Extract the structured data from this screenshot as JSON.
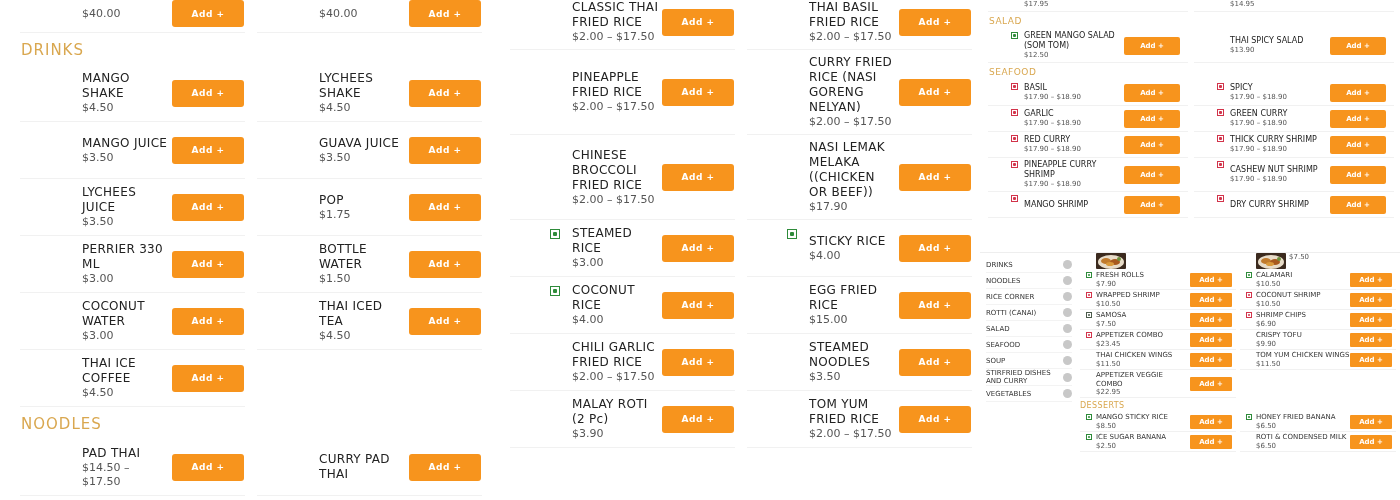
{
  "panels": [
    {
      "kind": "large",
      "blocks": [
        {
          "kind": "row",
          "items": [
            {
              "price": "$40.00",
              "button": "Add +"
            },
            {
              "price": "$40.00",
              "button": "Add +"
            }
          ]
        },
        {
          "kind": "heading",
          "text": "DRINKS"
        },
        {
          "kind": "row",
          "items": [
            {
              "name": "MANGO SHAKE",
              "price": "$4.50",
              "button": "Add +"
            },
            {
              "name": "LYCHEES SHAKE",
              "price": "$4.50",
              "button": "Add +"
            }
          ]
        },
        {
          "kind": "row",
          "items": [
            {
              "name": "MANGO JUICE",
              "price": "$3.50",
              "button": "Add +"
            },
            {
              "name": "GUAVA JUICE",
              "price": "$3.50",
              "button": "Add +"
            }
          ]
        },
        {
          "kind": "row",
          "items": [
            {
              "name": "LYCHEES JUICE",
              "price": "$3.50",
              "button": "Add +"
            },
            {
              "name": "POP",
              "price": "$1.75",
              "button": "Add +"
            }
          ]
        },
        {
          "kind": "row",
          "items": [
            {
              "name": "PERRIER 330 ML",
              "price": "$3.00",
              "button": "Add +"
            },
            {
              "name": "BOTTLE WATER",
              "price": "$1.50",
              "button": "Add +"
            }
          ]
        },
        {
          "kind": "row",
          "items": [
            {
              "name": "COCONUT WATER",
              "price": "$3.00",
              "button": "Add +"
            },
            {
              "name": "THAI ICED TEA",
              "price": "$4.50",
              "button": "Add +"
            }
          ]
        },
        {
          "kind": "row",
          "items": [
            {
              "name": "THAI ICE COFFEE",
              "price": "$4.50",
              "button": "Add +"
            }
          ]
        },
        {
          "kind": "heading",
          "text": "NOODLES"
        },
        {
          "kind": "row",
          "items": [
            {
              "name": "PAD THAI",
              "price": "$14.50 – $17.50",
              "button": "Add +"
            },
            {
              "name": "CURRY PAD THAI",
              "button": "Add +"
            }
          ]
        }
      ]
    },
    {
      "kind": "large",
      "blocks": [
        {
          "kind": "row",
          "items": [
            {
              "name": "CLASSIC THAI FRIED RICE",
              "price": "$2.00 – $17.50",
              "button": "Add +"
            },
            {
              "name": "THAI BASIL FRIED RICE",
              "price": "$2.00 – $17.50",
              "button": "Add +"
            }
          ]
        },
        {
          "kind": "row",
          "items": [
            {
              "name": "PINEAPPLE FRIED RICE",
              "price": "$2.00 – $17.50",
              "button": "Add +"
            },
            {
              "name": "CURRY FRIED RICE (NASI GORENG NELYAN)",
              "price": "$2.00 – $17.50",
              "button": "Add +"
            }
          ]
        },
        {
          "kind": "row",
          "items": [
            {
              "name": "CHINESE BROCCOLI FRIED RICE",
              "price": "$2.00 – $17.50",
              "button": "Add +"
            },
            {
              "name": "NASI LEMAK MELAKA ((CHICKEN OR BEEF))",
              "price": "$17.90",
              "button": "Add +"
            }
          ]
        },
        {
          "kind": "row",
          "items": [
            {
              "name": "STEAMED RICE",
              "price": "$3.00",
              "color": "#2e8b3a",
              "button": "Add +"
            },
            {
              "name": "STICKY RICE",
              "price": "$4.00",
              "color": "#2e8b3a",
              "button": "Add +"
            }
          ]
        },
        {
          "kind": "row",
          "items": [
            {
              "name": "COCONUT RICE",
              "price": "$4.00",
              "color": "#2e8b3a",
              "button": "Add +"
            },
            {
              "name": "EGG FRIED RICE",
              "price": "$15.00",
              "button": "Add +"
            }
          ]
        },
        {
          "kind": "row",
          "items": [
            {
              "name": "CHILI GARLIC FRIED RICE",
              "price": "$2.00 – $17.50",
              "button": "Add +"
            },
            {
              "name": "STEAMED NOODLES",
              "price": "$3.50",
              "button": "Add +"
            }
          ]
        },
        {
          "kind": "row",
          "items": [
            {
              "name": "MALAY ROTI (2 Pc)",
              "price": "$3.90",
              "button": "Add +"
            },
            {
              "name": "TOM YUM FRIED RICE",
              "price": "$2.00 – $17.50",
              "button": "Add +"
            }
          ]
        }
      ]
    },
    {
      "kind": "compact",
      "blocks": [
        {
          "kind": "row",
          "items": [
            {
              "price": "$17.95"
            },
            {
              "price": "$14.95"
            }
          ]
        },
        {
          "kind": "heading",
          "text": "SALAD"
        },
        {
          "kind": "row",
          "items": [
            {
              "name": "GREEN MANGO SALAD (SOM TOM)",
              "price": "$12.50",
              "color": "#2e8b3a",
              "button": "Add +"
            },
            {
              "name": "THAI SPICY SALAD",
              "price": "$13.90",
              "button": "Add +"
            }
          ]
        },
        {
          "kind": "heading",
          "text": "SEAFOOD"
        },
        {
          "kind": "row",
          "items": [
            {
              "name": "BASIL",
              "price": "$17.90 – $18.90",
              "color": "#d2334a",
              "button": "Add +"
            },
            {
              "name": "SPICY",
              "price": "$17.90 – $18.90",
              "color": "#d2334a",
              "button": "Add +"
            }
          ]
        },
        {
          "kind": "row",
          "items": [
            {
              "name": "GARLIC",
              "price": "$17.90 – $18.90",
              "color": "#d2334a",
              "button": "Add +"
            },
            {
              "name": "GREEN CURRY",
              "price": "$17.90 – $18.90",
              "color": "#d2334a",
              "button": "Add +"
            }
          ]
        },
        {
          "kind": "row",
          "items": [
            {
              "name": "RED CURRY",
              "price": "$17.90 – $18.90",
              "color": "#d2334a",
              "button": "Add +"
            },
            {
              "name": "THICK CURRY SHRIMP",
              "price": "$17.90 – $18.90",
              "color": "#d2334a",
              "button": "Add +"
            }
          ]
        },
        {
          "kind": "row",
          "items": [
            {
              "name": "PINEAPPLE CURRY SHRIMP",
              "price": "$17.90 – $18.90",
              "color": "#d2334a",
              "button": "Add +"
            },
            {
              "name": "CASHEW NUT SHRIMP",
              "price": "$17.90 – $18.90",
              "color": "#d2334a",
              "button": "Add +"
            }
          ]
        },
        {
          "kind": "row",
          "items": [
            {
              "name": "MANGO SHRIMP",
              "color": "#d2334a",
              "button": "Add +"
            },
            {
              "name": "DRY CURRY SHRIMP",
              "color": "#d2334a",
              "button": "Add +"
            }
          ]
        }
      ],
      "browser": {
        "categories": [
          {
            "name": "DRINKS"
          },
          {
            "name": "NOODLES"
          },
          {
            "name": "RICE CORNER"
          },
          {
            "name": "ROTTI (CANAI)"
          },
          {
            "name": "SALAD"
          },
          {
            "name": "SEAFOOD"
          },
          {
            "name": "SOUP"
          },
          {
            "name": "STIRFRIED DISHES AND CURRY"
          },
          {
            "name": "VEGETABLES"
          }
        ],
        "blocks": [
          {
            "kind": "photos",
            "items": [
              {
                "kind": "picture"
              },
              {
                "kind": "picture",
                "price": "$7.50"
              }
            ]
          },
          {
            "kind": "row",
            "items": [
              {
                "name": "FRESH ROLLS",
                "price": "$7.90",
                "color": "#2e8b3a",
                "button": "Add +"
              },
              {
                "name": "CALAMARI",
                "price": "$10.50",
                "color": "#2e8b3a",
                "button": "Add +"
              }
            ]
          },
          {
            "kind": "row",
            "items": [
              {
                "name": "WRAPPED SHRIMP",
                "price": "$10.50",
                "color": "#d2334a",
                "button": "Add +"
              },
              {
                "name": "COCONUT SHRIMP",
                "price": "$10.50",
                "color": "#d2334a",
                "button": "Add +"
              }
            ]
          },
          {
            "kind": "row",
            "items": [
              {
                "name": "SAMOSA",
                "price": "$7.50",
                "color": "#4a5a4a",
                "button": "Add +"
              },
              {
                "name": "SHRIMP CHIPS",
                "price": "$6.90",
                "color": "#d2334a",
                "button": "Add +"
              }
            ]
          },
          {
            "kind": "row",
            "items": [
              {
                "name": "APPETIZER COMBO",
                "price": "$23.45",
                "color": "#d2334a",
                "button": "Add +"
              },
              {
                "name": "CRISPY TOFU",
                "price": "$9.90",
                "button": "Add +"
              }
            ]
          },
          {
            "kind": "row",
            "items": [
              {
                "name": "THAI CHICKEN WINGS",
                "price": "$11.50",
                "button": "Add +"
              },
              {
                "name": "TOM YUM CHICKEN WINGS",
                "price": "$11.50",
                "button": "Add +"
              }
            ]
          },
          {
            "kind": "row",
            "items": [
              {
                "name": "APPETIZER VEGGIE COMBO",
                "price": "$22.95",
                "button": "Add +"
              }
            ]
          },
          {
            "kind": "heading",
            "text": "DESSERTS"
          },
          {
            "kind": "row",
            "items": [
              {
                "name": "MANGO STICKY RICE",
                "price": "$8.50",
                "color": "#2e8b3a",
                "button": "Add +"
              },
              {
                "name": "HONEY FRIED BANANA",
                "price": "$6.50",
                "color": "#2e8b3a",
                "button": "Add +"
              }
            ]
          },
          {
            "kind": "row",
            "items": [
              {
                "name": "ICE SUGAR BANANA",
                "price": "$2.50",
                "color": "#2e8b3a",
                "button": "Add +"
              },
              {
                "name": "ROTI & CONDENSED MILK",
                "price": "$6.50",
                "button": "Add +"
              }
            ]
          }
        ]
      }
    }
  ]
}
